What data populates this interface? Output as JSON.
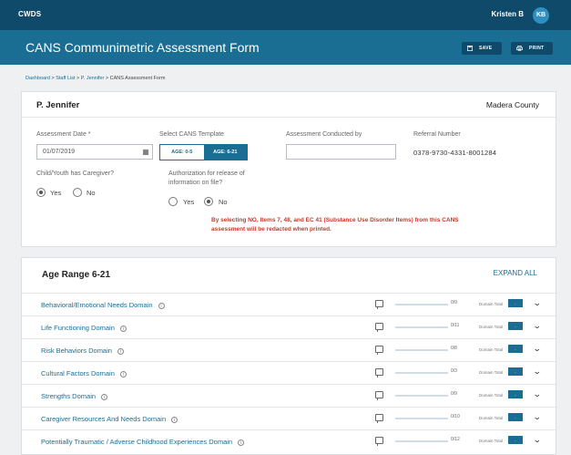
{
  "app": {
    "name": "CWDS",
    "user_name": "Kristen B",
    "user_initials": "KB"
  },
  "header": {
    "title": "CANS Communimetric Assessment Form",
    "save_label": "SAVE",
    "print_label": "PRINT",
    "save_icon": "save-icon",
    "print_icon": "printer-icon"
  },
  "breadcrumb": {
    "dashboard": "Dashboard",
    "staff_list": "Staff List",
    "client": "P. Jennifer",
    "current": "CANS Assessment Form",
    "sep": " > "
  },
  "client": {
    "name": "P. Jennifer",
    "county": "Madera County"
  },
  "form": {
    "assessment_date_label": "Assessment Date *",
    "assessment_date_value": "01/07/2019",
    "template_label": "Select CANS Template",
    "template_options": [
      "AGE: 0-5",
      "AGE: 6-21"
    ],
    "template_selected": "AGE: 6-21",
    "conducted_by_label": "Assessment Conducted by",
    "conducted_by_value": "",
    "referral_label": "Referral Number",
    "referral_value": "0378-9730-4331-8001284",
    "caregiver_label": "Child/Youth has Caregiver?",
    "caregiver_yes": "Yes",
    "caregiver_no": "No",
    "caregiver_selected": "Yes",
    "authorization_label_line1": "Authorization for release of",
    "authorization_label_line2": "information on file?",
    "authorization_yes": "Yes",
    "authorization_no": "No",
    "authorization_selected": "No",
    "warning_line1": "By selecting NO, Items 7, 48, and EC 41 (Substance Use Disorder Items) from this CANS",
    "warning_line2": "assessment will be redacted when printed."
  },
  "domains_section": {
    "title": "Age Range 6-21",
    "expand_all": "EXPAND ALL",
    "info_icon": "info-icon",
    "comment_icon": "comment-icon",
    "chevron_icon": "chevron-down-icon",
    "domain_total_label": "Domain Total",
    "domain_total_value": "-",
    "items": [
      {
        "name": "Behavioral/Emotional Needs Domain",
        "progress": "0/9",
        "fraction": 0
      },
      {
        "name": "Life Functioning Domain",
        "progress": "0/11",
        "fraction": 0
      },
      {
        "name": "Risk Behaviors Domain",
        "progress": "0/8",
        "fraction": 0
      },
      {
        "name": "Cultural Factors Domain",
        "progress": "0/3",
        "fraction": 0
      },
      {
        "name": "Strengths Domain",
        "progress": "0/9",
        "fraction": 0
      },
      {
        "name": "Caregiver Resources And Needs Domain",
        "progress": "0/10",
        "fraction": 0
      },
      {
        "name": "Potentially Traumatic / Adverse Childhood Experiences Domain",
        "progress": "0/12",
        "fraction": 0
      }
    ]
  }
}
